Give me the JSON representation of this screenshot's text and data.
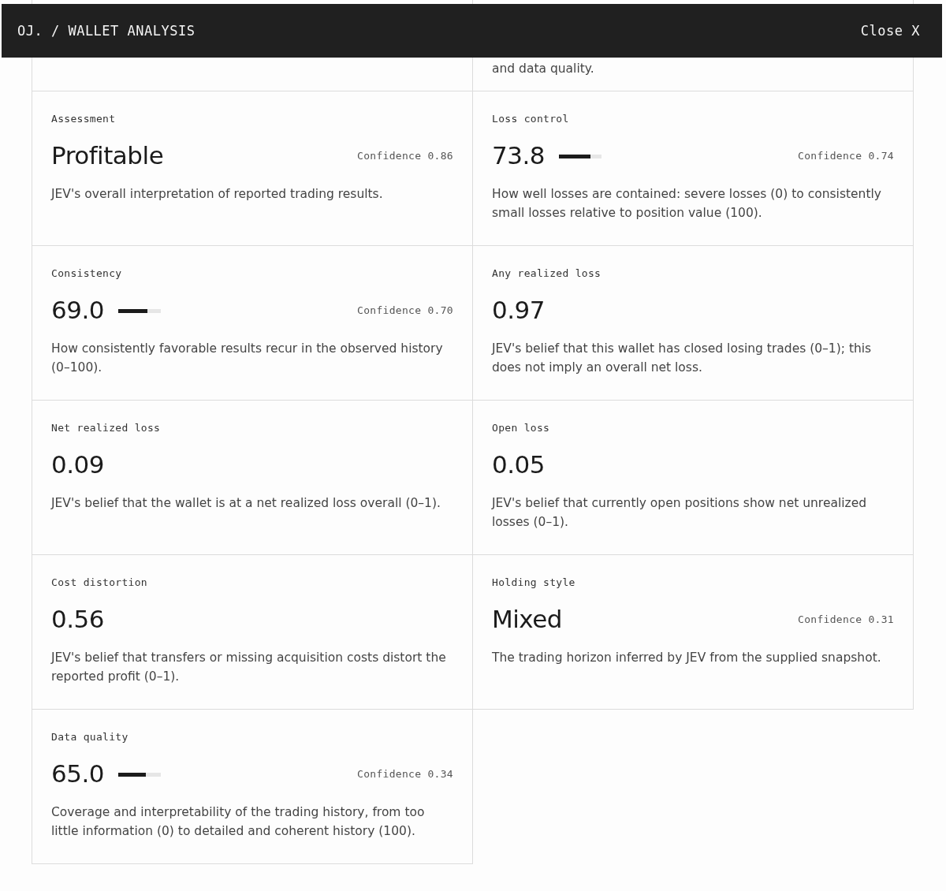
{
  "header": {
    "title": "OJ. / WALLET ANALYSIS",
    "close": "Close X"
  },
  "partial_card": {
    "description": "and data quality."
  },
  "metrics": [
    {
      "label": "Assessment",
      "value": "Profitable",
      "confidence": "Confidence 0.86",
      "description": "JEV's overall interpretation of reported trading results."
    },
    {
      "label": "Loss control",
      "value": "73.8",
      "level": 0.738,
      "confidence": "Confidence 0.74",
      "description": "How well losses are contained: severe losses (0) to consistently small losses relative to position value (100)."
    },
    {
      "label": "Consistency",
      "value": "69.0",
      "level": 0.69,
      "confidence": "Confidence 0.70",
      "description": "How consistently favorable results recur in the observed history (0–100)."
    },
    {
      "label": "Any realized loss",
      "value": "0.97",
      "description": "JEV's belief that this wallet has closed losing trades (0–1); this does not imply an overall net loss."
    },
    {
      "label": "Net realized loss",
      "value": "0.09",
      "description": "JEV's belief that the wallet is at a net realized loss overall (0–1)."
    },
    {
      "label": "Open loss",
      "value": "0.05",
      "description": "JEV's belief that currently open positions show net unrealized losses (0–1)."
    },
    {
      "label": "Cost distortion",
      "value": "0.56",
      "description": "JEV's belief that transfers or missing acquisition costs distort the reported profit (0–1)."
    },
    {
      "label": "Holding style",
      "value": "Mixed",
      "confidence": "Confidence 0.31",
      "description": "The trading horizon inferred by JEV from the supplied snapshot."
    },
    {
      "label": "Data quality",
      "value": "65.0",
      "level": 0.65,
      "confidence": "Confidence 0.34",
      "description": "Coverage and interpretability of the trading history, from too little information (0) to detailed and coherent history (100)."
    }
  ]
}
